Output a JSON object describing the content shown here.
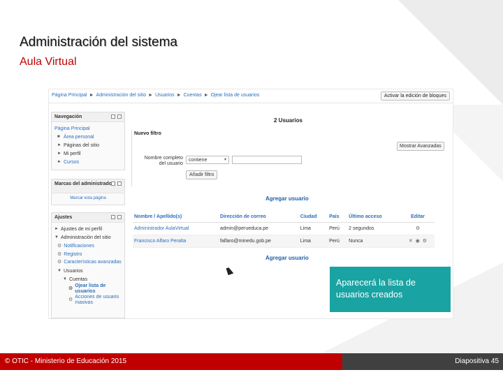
{
  "slide": {
    "title": "Administración del sistema",
    "subtitle": "Aula Virtual",
    "callout": "Aparecerá la lista de usuarios creados",
    "footer_left": "© OTIC - Ministerio de Educación 2015",
    "footer_right": "Diapositiva 45",
    "colors": {
      "red": "#c00000",
      "teal": "#1aa3a3",
      "dark": "#404040"
    }
  },
  "moodle": {
    "breadcrumb": [
      "Página Principal",
      "Administración del sitio",
      "Usuarios",
      "Cuentas",
      "Ojear lista de usuarios"
    ],
    "breadcrumb_sep": "►",
    "edit_button": "Activar la edición de bloques",
    "nav_block": {
      "title": "Navegación",
      "items": [
        {
          "label": "Página Principal",
          "icon": ""
        },
        {
          "label": "Área personal",
          "icon": "■"
        },
        {
          "label": "Páginas del sitio",
          "icon": "►"
        },
        {
          "label": "Mi perfil",
          "icon": "►"
        },
        {
          "label": "Cursos",
          "icon": "►"
        }
      ]
    },
    "bookmarks_block": {
      "title": "Marcas del administrador",
      "link": "Marcar esta página"
    },
    "settings_block": {
      "title": "Ajustes",
      "profile": "Ajustes de mi perfil",
      "admin": "Administración del sitio",
      "items": [
        "Notificaciones",
        "Registro",
        "Características avanzadas"
      ],
      "users": "Usuarios",
      "accounts": "Cuentas",
      "browse": "Ojear lista de usuarios",
      "bulk": "Acciones de usuario masivas"
    },
    "page_title": "2 Usuarios",
    "filter": {
      "heading": "Nuevo filtro",
      "advanced_button": "Mostrar Avanzadas",
      "field_label": "Nombre completo del usuario",
      "operator": "contiene",
      "value": "",
      "add_button": "Añadir filtro"
    },
    "add_user": "Agregar usuario",
    "table": {
      "headers": [
        "Nombre / Apellido(s)",
        "Dirección de correo",
        "Ciudad",
        "País",
        "Último acceso",
        "Editar"
      ],
      "rows": [
        {
          "name": "Administrador AulaVirtual",
          "email": "admin@perueduca.pe",
          "city": "Lima",
          "country": "Perú",
          "last": "2 segundos"
        },
        {
          "name": "Francisco Alfaro Peralta",
          "email": "falfaro@minedu.gob.pe",
          "city": "Lima",
          "country": "Perú",
          "last": "Nunca"
        }
      ]
    }
  }
}
